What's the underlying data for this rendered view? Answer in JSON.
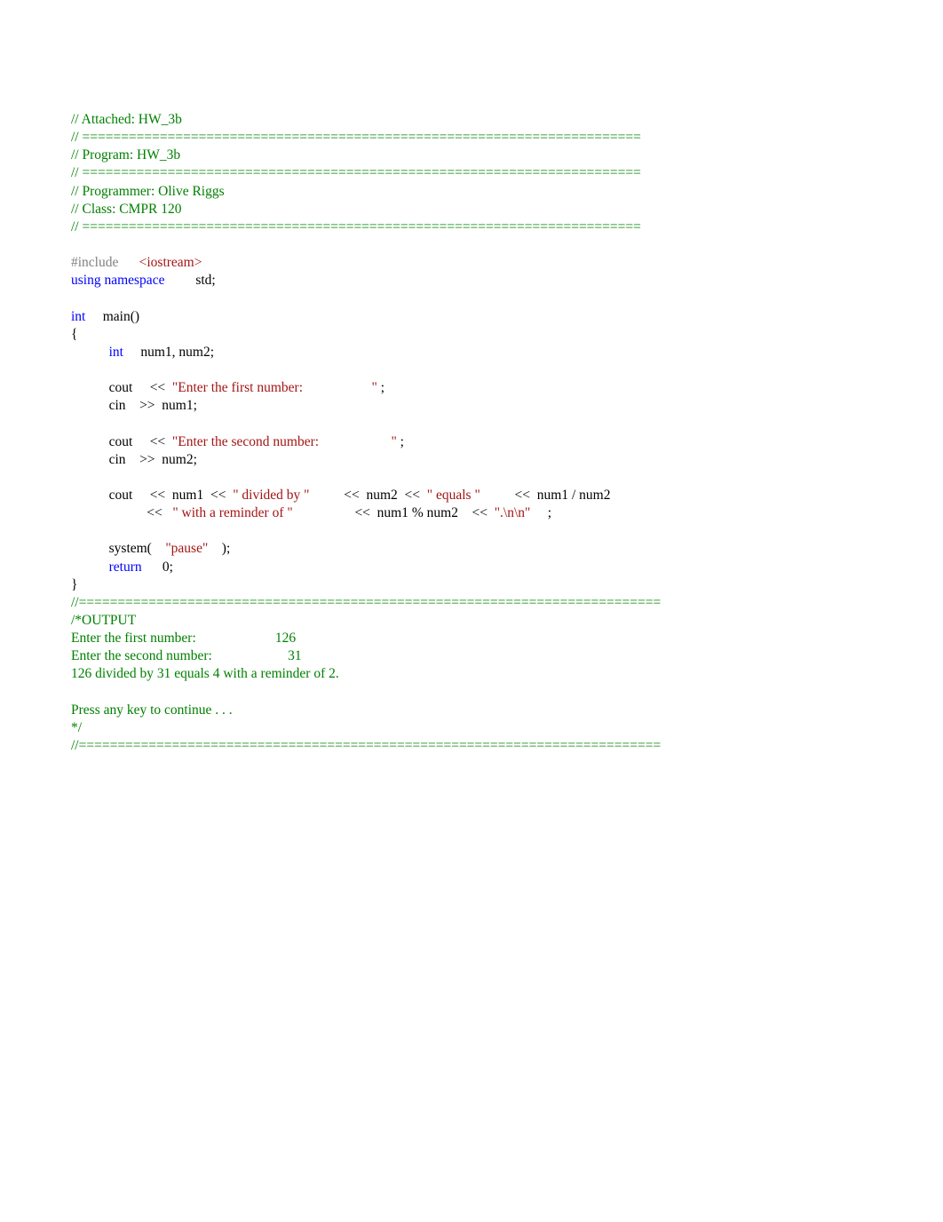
{
  "header": {
    "attached": "// Attached: HW_3b",
    "divider": "// ========================================================================",
    "program": "// Program: HW_3b",
    "programmer": "// Programmer: Olive Riggs",
    "class": "// Class: CMPR 120"
  },
  "include": {
    "directive": "#include",
    "spaces1": "      ",
    "open": "<iostream>"
  },
  "using": {
    "kw": "using namespace",
    "spaces": "         ",
    "std": "std;"
  },
  "main": {
    "kw_int": "int",
    "spaces1": "     ",
    "fn": "main()",
    "brace_open": "{",
    "indent1": "           ",
    "decl_int": "int",
    "decl_spaces": "     ",
    "decl_vars": "num1, num2;"
  },
  "cout1": {
    "indent": "           ",
    "cout": "cout ",
    "spaces1": "    ",
    "op": "<<",
    "spaces2": "  ",
    "str": "\"Enter the first number: ",
    "spaces3": "                   ",
    "endq": "\"",
    "semi": " ;"
  },
  "cin1": {
    "indent": "           ",
    "cin": "cin ",
    "spaces1": "   ",
    "op": ">>",
    "spaces2": "  ",
    "var": "num1;"
  },
  "cout2": {
    "indent": "           ",
    "cout": "cout ",
    "spaces1": "    ",
    "op": "<<",
    "spaces2": "  ",
    "str": "\"Enter the second number: ",
    "spaces3": "                    ",
    "endq": "\"",
    "semi": " ;"
  },
  "cin2": {
    "indent": "           ",
    "cin": "cin ",
    "spaces1": "   ",
    "op": ">>",
    "spaces2": "  ",
    "var": "num2;"
  },
  "cout3": {
    "indent": "           ",
    "cout": "cout ",
    "spaces1": "    ",
    "op1": "<<",
    "spaces2": "  ",
    "num1": "num1 ",
    "spaces3": " ",
    "op2": "<<",
    "spaces4": "  ",
    "str1": "\" divided by \"",
    "spaces5": "          ",
    "op3": "<<",
    "spaces6": "  ",
    "num2": "num2 ",
    "spaces7": " ",
    "op4": "<<",
    "spaces8": "  ",
    "str2": "\" equals \"",
    "spaces9": "          ",
    "op5": "<<",
    "spaces10": "  ",
    "div": "num1 / num2"
  },
  "cout3b": {
    "indent": "                      ",
    "op1": "<<",
    "spaces1": "   ",
    "str1": "\" with a reminder of \"",
    "spaces2": "                  ",
    "op2": "<<",
    "spaces3": "  ",
    "mod": "num1 % num2 ",
    "spaces4": "   ",
    "op3": "<<",
    "spaces5": "  ",
    "str2": "\".\\n\\n\"",
    "spaces6": "     ",
    "semi": ";"
  },
  "system": {
    "indent": "           ",
    "call": "system(",
    "spaces1": "    ",
    "str": "\"pause\"",
    "spaces2": "    ",
    "close": ");"
  },
  "return": {
    "indent": "           ",
    "kw": "return",
    "spaces": "      ",
    "val": "0;"
  },
  "brace_close": "}",
  "footer": {
    "divider2": "//===========================================================================",
    "output_start": "/*OUTPUT",
    "out1a": "Enter the first number:",
    "out1b": "                       ",
    "out1c": "126",
    "out2a": "Enter the second number:",
    "out2b": "                      ",
    "out2c": "31",
    "out3": "126 divided by 31 equals 4 with a reminder of 2.",
    "blank": "",
    "press": "Press any key to continue . . .",
    "end": "*/",
    "divider3": "//==========================================================================="
  }
}
